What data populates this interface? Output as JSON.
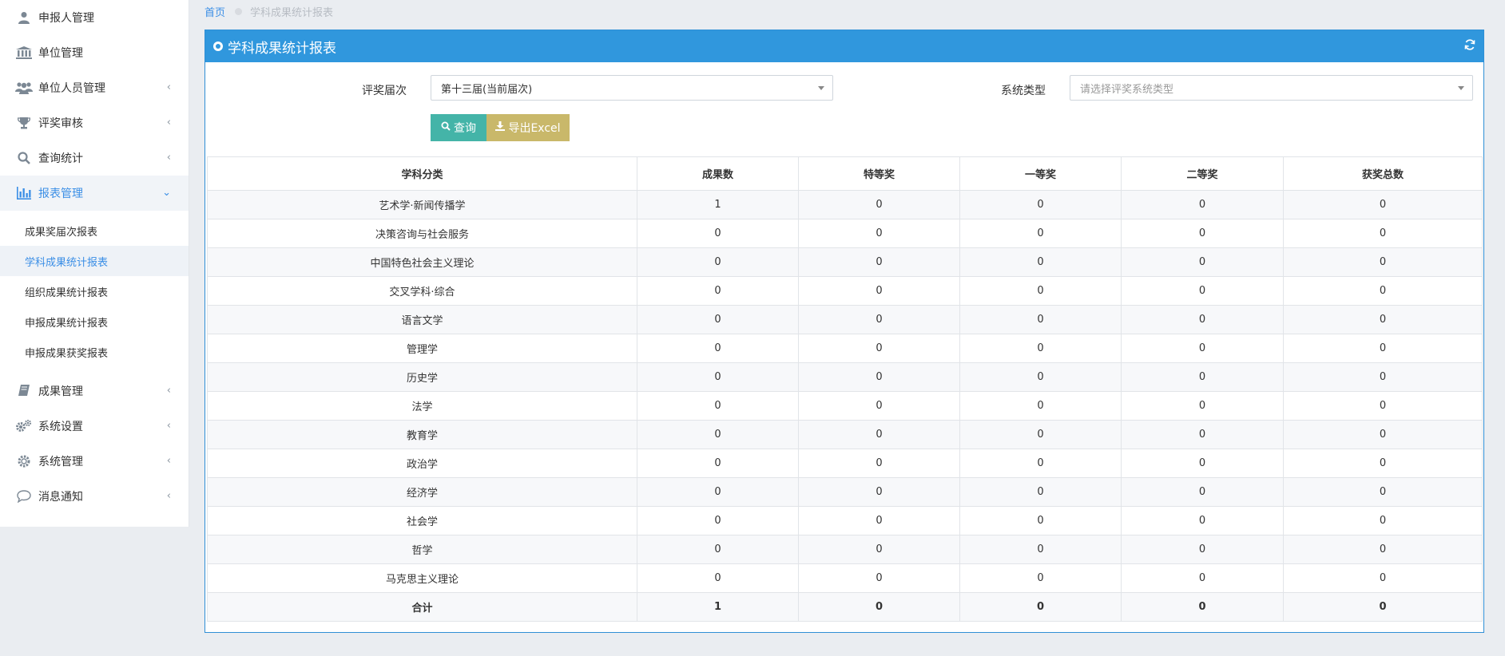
{
  "sidebar": {
    "items": [
      {
        "label": "申报人管理",
        "icon": "user-icon"
      },
      {
        "label": "单位管理",
        "icon": "bank-icon"
      },
      {
        "label": "单位人员管理",
        "icon": "users-icon",
        "chevron": "‹"
      },
      {
        "label": "评奖审核",
        "icon": "trophy-icon",
        "chevron": "‹"
      },
      {
        "label": "查询统计",
        "icon": "search-icon",
        "chevron": "‹"
      },
      {
        "label": "报表管理",
        "icon": "bar-chart-icon",
        "chevron": "⌄"
      }
    ],
    "submenu": [
      {
        "label": "成果奖届次报表"
      },
      {
        "label": "学科成果统计报表"
      },
      {
        "label": "组织成果统计报表"
      },
      {
        "label": "申报成果统计报表"
      },
      {
        "label": "申报成果获奖报表"
      }
    ],
    "items_after": [
      {
        "label": "成果管理",
        "icon": "book-icon",
        "chevron": "‹"
      },
      {
        "label": "系统设置",
        "icon": "gears-icon",
        "chevron": "‹"
      },
      {
        "label": "系统管理",
        "icon": "gear-icon",
        "chevron": "‹"
      },
      {
        "label": "消息通知",
        "icon": "chat-icon",
        "chevron": "‹"
      }
    ]
  },
  "breadcrumb": {
    "home": "首页",
    "current": "学科成果统计报表"
  },
  "panel": {
    "title": "学科成果统计报表"
  },
  "form": {
    "award_label": "评奖届次",
    "award_value": "第十三届(当前届次)",
    "system_label": "系统类型",
    "system_placeholder": "请选择评奖系统类型",
    "query_label": "查询",
    "export_label": "导出Excel"
  },
  "table": {
    "headers": [
      "学科分类",
      "成果数",
      "特等奖",
      "一等奖",
      "二等奖",
      "获奖总数"
    ],
    "rows": [
      [
        "艺术学·新闻传播学",
        "1",
        "0",
        "0",
        "0",
        "0"
      ],
      [
        "决策咨询与社会服务",
        "0",
        "0",
        "0",
        "0",
        "0"
      ],
      [
        "中国特色社会主义理论",
        "0",
        "0",
        "0",
        "0",
        "0"
      ],
      [
        "交叉学科·综合",
        "0",
        "0",
        "0",
        "0",
        "0"
      ],
      [
        "语言文学",
        "0",
        "0",
        "0",
        "0",
        "0"
      ],
      [
        "管理学",
        "0",
        "0",
        "0",
        "0",
        "0"
      ],
      [
        "历史学",
        "0",
        "0",
        "0",
        "0",
        "0"
      ],
      [
        "法学",
        "0",
        "0",
        "0",
        "0",
        "0"
      ],
      [
        "教育学",
        "0",
        "0",
        "0",
        "0",
        "0"
      ],
      [
        "政治学",
        "0",
        "0",
        "0",
        "0",
        "0"
      ],
      [
        "经济学",
        "0",
        "0",
        "0",
        "0",
        "0"
      ],
      [
        "社会学",
        "0",
        "0",
        "0",
        "0",
        "0"
      ],
      [
        "哲学",
        "0",
        "0",
        "0",
        "0",
        "0"
      ],
      [
        "马克思主义理论",
        "0",
        "0",
        "0",
        "0",
        "0"
      ]
    ],
    "total": [
      "合计",
      "1",
      "0",
      "0",
      "0",
      "0"
    ]
  },
  "colors": {
    "accent": "#3097dd",
    "query": "#44b4a8",
    "export": "#c9b86a"
  }
}
